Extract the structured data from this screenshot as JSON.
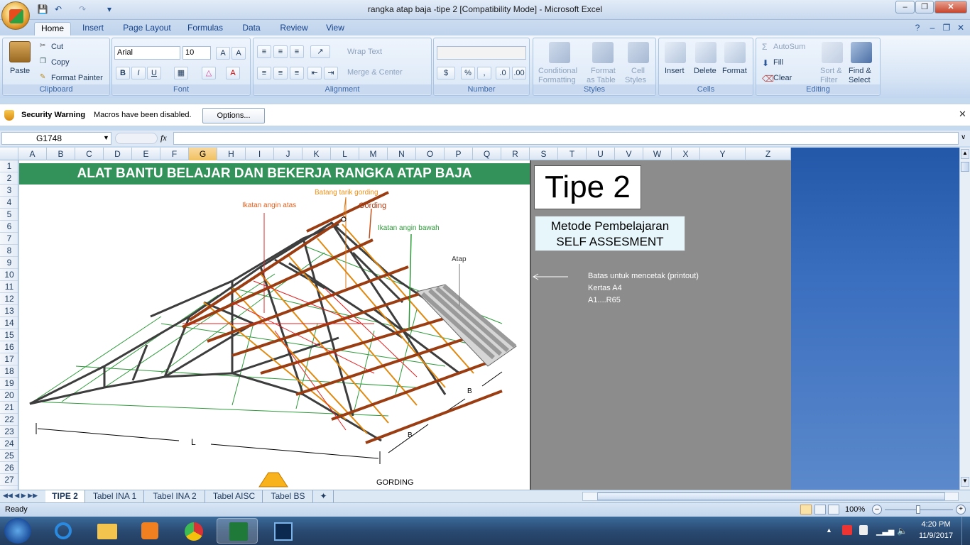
{
  "window": {
    "title": "rangka atap baja -tipe 2  [Compatibility Mode] - Microsoft Excel"
  },
  "ribbon_tabs": [
    "Home",
    "Insert",
    "Page Layout",
    "Formulas",
    "Data",
    "Review",
    "View"
  ],
  "ribbon": {
    "clipboard": {
      "paste": "Paste",
      "cut": "Cut",
      "copy": "Copy",
      "format_painter": "Format Painter",
      "label": "Clipboard"
    },
    "font": {
      "font_name": "Arial",
      "font_size": "10",
      "bold": "B",
      "italic": "I",
      "underline": "U",
      "label": "Font"
    },
    "alignment": {
      "wrap_text": "Wrap Text",
      "merge_center": "Merge & Center",
      "label": "Alignment"
    },
    "number": {
      "currency": "$",
      "percent": "%",
      "comma": ",",
      "label": "Number"
    },
    "styles": {
      "conditional": "Conditional",
      "formatting": "Formatting",
      "format_as": "Format",
      "as_table": "as Table",
      "cell": "Cell",
      "styles_btn": "Styles",
      "label": "Styles"
    },
    "cells": {
      "insert": "Insert",
      "delete": "Delete",
      "format": "Format",
      "label": "Cells"
    },
    "editing": {
      "autosum": "AutoSum",
      "fill": "Fill",
      "clear": "Clear",
      "sort": "Sort &",
      "filter": "Filter",
      "find": "Find &",
      "select": "Select",
      "label": "Editing"
    }
  },
  "security": {
    "title": "Security Warning",
    "message": "Macros have been disabled.",
    "options": "Options..."
  },
  "formula_bar": {
    "name_box": "G1748",
    "fx": "fx",
    "value": ""
  },
  "columns": [
    "A",
    "B",
    "C",
    "D",
    "E",
    "F",
    "G",
    "H",
    "I",
    "J",
    "K",
    "L",
    "M",
    "N",
    "O",
    "P",
    "Q",
    "R",
    "S",
    "T",
    "U",
    "V",
    "W",
    "X",
    "Y",
    "Z"
  ],
  "selected_column": "G",
  "rows": [
    "1",
    "2",
    "3",
    "4",
    "5",
    "6",
    "7",
    "8",
    "9",
    "10",
    "11",
    "12",
    "13",
    "14",
    "15",
    "16",
    "17",
    "18",
    "19",
    "20",
    "21",
    "22",
    "23",
    "24",
    "25",
    "26",
    "27"
  ],
  "sheet": {
    "banner": "ALAT BANTU BELAJAR DAN BEKERJA RANGKA ATAP BAJA",
    "tipe": "Tipe 2",
    "metode_line1": "Metode Pembelajaran",
    "metode_line2": "SELF  ASSESMENT",
    "note1": "Batas untuk mencetak (printout)",
    "note2": "Kertas A4",
    "note3": "A1....R65",
    "diagram_labels": {
      "batang": "Batang tarik gording",
      "ikatan_atas": "Ikatan angin atas",
      "gording": "Gording",
      "ikatan_bawah": "Ikatan angin bawah",
      "atap": "Atap",
      "b1": "B",
      "b2": "B",
      "l": "L",
      "gording2": "GORDING"
    }
  },
  "sheet_tabs": [
    "TIPE 2",
    "Tabel INA 1",
    "Tabel INA 2",
    "Tabel AISC",
    "Tabel BS"
  ],
  "active_sheet": "TIPE 2",
  "status": {
    "ready": "Ready",
    "zoom": "100%"
  },
  "taskbar": {
    "time": "4:20 PM",
    "date": "11/9/2017"
  },
  "colors": {
    "banner": "#33925a",
    "gray_area": "#8c8c8c",
    "accent": "#15428b"
  }
}
